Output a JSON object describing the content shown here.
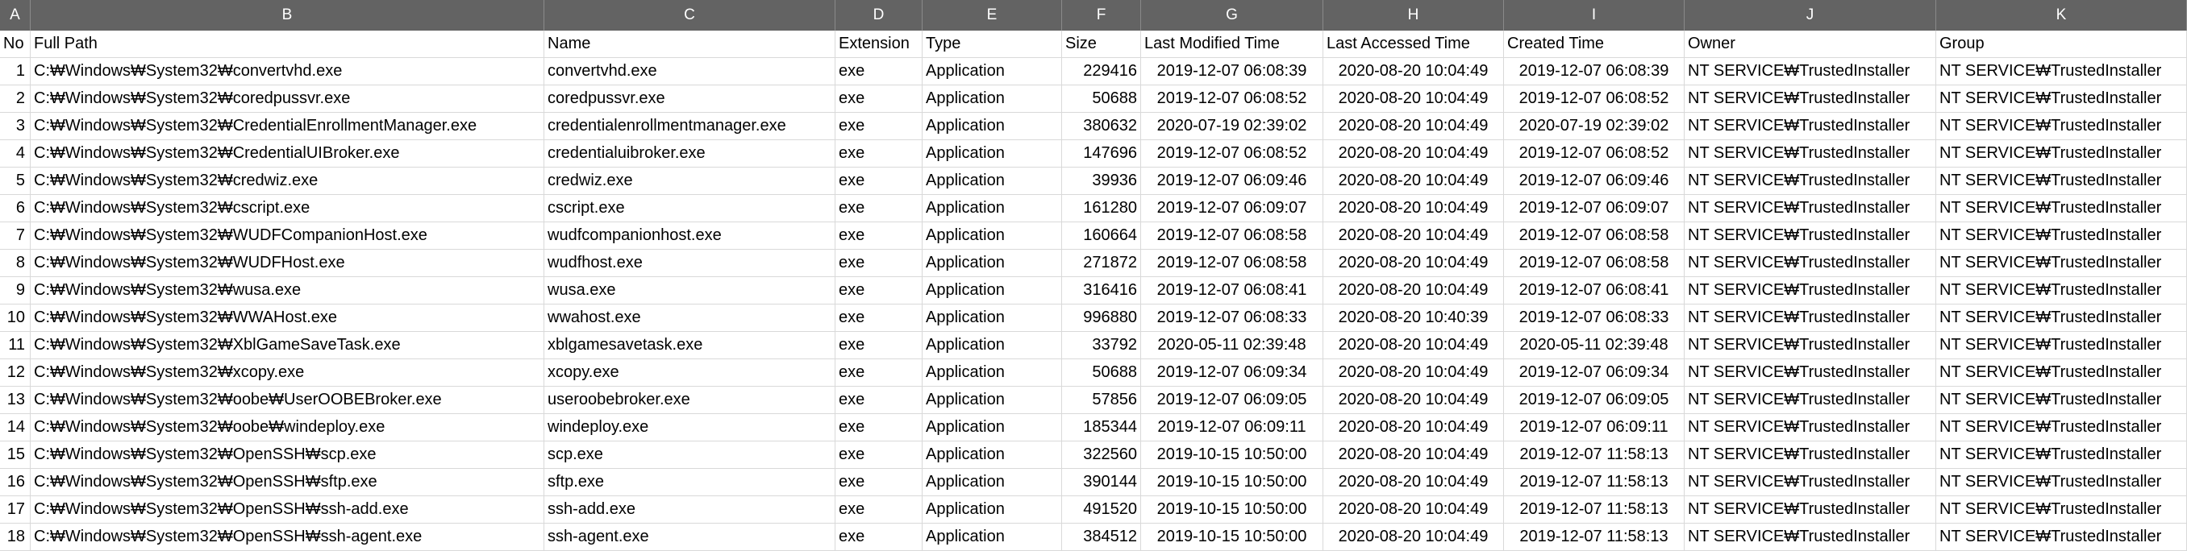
{
  "column_letters": [
    "A",
    "B",
    "C",
    "D",
    "E",
    "F",
    "G",
    "H",
    "I",
    "J",
    "K"
  ],
  "headers": {
    "no": "No",
    "full_path": "Full Path",
    "name": "Name",
    "extension": "Extension",
    "type": "Type",
    "size": "Size",
    "last_modified": "Last Modified Time",
    "last_accessed": "Last Accessed Time",
    "created": "Created Time",
    "owner": "Owner",
    "group": "Group"
  },
  "rows": [
    {
      "no": "1",
      "full_path": "C:₩Windows₩System32₩convertvhd.exe",
      "name": "convertvhd.exe",
      "extension": "exe",
      "type": "Application",
      "size": "229416",
      "last_modified": "2019-12-07 06:08:39",
      "last_accessed": "2020-08-20 10:04:49",
      "created": "2019-12-07 06:08:39",
      "owner": "NT SERVICE₩TrustedInstaller",
      "group": "NT SERVICE₩TrustedInstaller"
    },
    {
      "no": "2",
      "full_path": "C:₩Windows₩System32₩coredpussvr.exe",
      "name": "coredpussvr.exe",
      "extension": "exe",
      "type": "Application",
      "size": "50688",
      "last_modified": "2019-12-07 06:08:52",
      "last_accessed": "2020-08-20 10:04:49",
      "created": "2019-12-07 06:08:52",
      "owner": "NT SERVICE₩TrustedInstaller",
      "group": "NT SERVICE₩TrustedInstaller"
    },
    {
      "no": "3",
      "full_path": "C:₩Windows₩System32₩CredentialEnrollmentManager.exe",
      "name": "credentialenrollmentmanager.exe",
      "extension": "exe",
      "type": "Application",
      "size": "380632",
      "last_modified": "2020-07-19 02:39:02",
      "last_accessed": "2020-08-20 10:04:49",
      "created": "2020-07-19 02:39:02",
      "owner": "NT SERVICE₩TrustedInstaller",
      "group": "NT SERVICE₩TrustedInstaller"
    },
    {
      "no": "4",
      "full_path": "C:₩Windows₩System32₩CredentialUIBroker.exe",
      "name": "credentialuibroker.exe",
      "extension": "exe",
      "type": "Application",
      "size": "147696",
      "last_modified": "2019-12-07 06:08:52",
      "last_accessed": "2020-08-20 10:04:49",
      "created": "2019-12-07 06:08:52",
      "owner": "NT SERVICE₩TrustedInstaller",
      "group": "NT SERVICE₩TrustedInstaller"
    },
    {
      "no": "5",
      "full_path": "C:₩Windows₩System32₩credwiz.exe",
      "name": "credwiz.exe",
      "extension": "exe",
      "type": "Application",
      "size": "39936",
      "last_modified": "2019-12-07 06:09:46",
      "last_accessed": "2020-08-20 10:04:49",
      "created": "2019-12-07 06:09:46",
      "owner": "NT SERVICE₩TrustedInstaller",
      "group": "NT SERVICE₩TrustedInstaller"
    },
    {
      "no": "6",
      "full_path": "C:₩Windows₩System32₩cscript.exe",
      "name": "cscript.exe",
      "extension": "exe",
      "type": "Application",
      "size": "161280",
      "last_modified": "2019-12-07 06:09:07",
      "last_accessed": "2020-08-20 10:04:49",
      "created": "2019-12-07 06:09:07",
      "owner": "NT SERVICE₩TrustedInstaller",
      "group": "NT SERVICE₩TrustedInstaller"
    },
    {
      "no": "7",
      "full_path": "C:₩Windows₩System32₩WUDFCompanionHost.exe",
      "name": "wudfcompanionhost.exe",
      "extension": "exe",
      "type": "Application",
      "size": "160664",
      "last_modified": "2019-12-07 06:08:58",
      "last_accessed": "2020-08-20 10:04:49",
      "created": "2019-12-07 06:08:58",
      "owner": "NT SERVICE₩TrustedInstaller",
      "group": "NT SERVICE₩TrustedInstaller"
    },
    {
      "no": "8",
      "full_path": "C:₩Windows₩System32₩WUDFHost.exe",
      "name": "wudfhost.exe",
      "extension": "exe",
      "type": "Application",
      "size": "271872",
      "last_modified": "2019-12-07 06:08:58",
      "last_accessed": "2020-08-20 10:04:49",
      "created": "2019-12-07 06:08:58",
      "owner": "NT SERVICE₩TrustedInstaller",
      "group": "NT SERVICE₩TrustedInstaller"
    },
    {
      "no": "9",
      "full_path": "C:₩Windows₩System32₩wusa.exe",
      "name": "wusa.exe",
      "extension": "exe",
      "type": "Application",
      "size": "316416",
      "last_modified": "2019-12-07 06:08:41",
      "last_accessed": "2020-08-20 10:04:49",
      "created": "2019-12-07 06:08:41",
      "owner": "NT SERVICE₩TrustedInstaller",
      "group": "NT SERVICE₩TrustedInstaller"
    },
    {
      "no": "10",
      "full_path": "C:₩Windows₩System32₩WWAHost.exe",
      "name": "wwahost.exe",
      "extension": "exe",
      "type": "Application",
      "size": "996880",
      "last_modified": "2019-12-07 06:08:33",
      "last_accessed": "2020-08-20 10:40:39",
      "created": "2019-12-07 06:08:33",
      "owner": "NT SERVICE₩TrustedInstaller",
      "group": "NT SERVICE₩TrustedInstaller"
    },
    {
      "no": "11",
      "full_path": "C:₩Windows₩System32₩XblGameSaveTask.exe",
      "name": "xblgamesavetask.exe",
      "extension": "exe",
      "type": "Application",
      "size": "33792",
      "last_modified": "2020-05-11 02:39:48",
      "last_accessed": "2020-08-20 10:04:49",
      "created": "2020-05-11 02:39:48",
      "owner": "NT SERVICE₩TrustedInstaller",
      "group": "NT SERVICE₩TrustedInstaller"
    },
    {
      "no": "12",
      "full_path": "C:₩Windows₩System32₩xcopy.exe",
      "name": "xcopy.exe",
      "extension": "exe",
      "type": "Application",
      "size": "50688",
      "last_modified": "2019-12-07 06:09:34",
      "last_accessed": "2020-08-20 10:04:49",
      "created": "2019-12-07 06:09:34",
      "owner": "NT SERVICE₩TrustedInstaller",
      "group": "NT SERVICE₩TrustedInstaller"
    },
    {
      "no": "13",
      "full_path": "C:₩Windows₩System32₩oobe₩UserOOBEBroker.exe",
      "name": "useroobebroker.exe",
      "extension": "exe",
      "type": "Application",
      "size": "57856",
      "last_modified": "2019-12-07 06:09:05",
      "last_accessed": "2020-08-20 10:04:49",
      "created": "2019-12-07 06:09:05",
      "owner": "NT SERVICE₩TrustedInstaller",
      "group": "NT SERVICE₩TrustedInstaller"
    },
    {
      "no": "14",
      "full_path": "C:₩Windows₩System32₩oobe₩windeploy.exe",
      "name": "windeploy.exe",
      "extension": "exe",
      "type": "Application",
      "size": "185344",
      "last_modified": "2019-12-07 06:09:11",
      "last_accessed": "2020-08-20 10:04:49",
      "created": "2019-12-07 06:09:11",
      "owner": "NT SERVICE₩TrustedInstaller",
      "group": "NT SERVICE₩TrustedInstaller"
    },
    {
      "no": "15",
      "full_path": "C:₩Windows₩System32₩OpenSSH₩scp.exe",
      "name": "scp.exe",
      "extension": "exe",
      "type": "Application",
      "size": "322560",
      "last_modified": "2019-10-15 10:50:00",
      "last_accessed": "2020-08-20 10:04:49",
      "created": "2019-12-07 11:58:13",
      "owner": "NT SERVICE₩TrustedInstaller",
      "group": "NT SERVICE₩TrustedInstaller"
    },
    {
      "no": "16",
      "full_path": "C:₩Windows₩System32₩OpenSSH₩sftp.exe",
      "name": "sftp.exe",
      "extension": "exe",
      "type": "Application",
      "size": "390144",
      "last_modified": "2019-10-15 10:50:00",
      "last_accessed": "2020-08-20 10:04:49",
      "created": "2019-12-07 11:58:13",
      "owner": "NT SERVICE₩TrustedInstaller",
      "group": "NT SERVICE₩TrustedInstaller"
    },
    {
      "no": "17",
      "full_path": "C:₩Windows₩System32₩OpenSSH₩ssh-add.exe",
      "name": "ssh-add.exe",
      "extension": "exe",
      "type": "Application",
      "size": "491520",
      "last_modified": "2019-10-15 10:50:00",
      "last_accessed": "2020-08-20 10:04:49",
      "created": "2019-12-07 11:58:13",
      "owner": "NT SERVICE₩TrustedInstaller",
      "group": "NT SERVICE₩TrustedInstaller"
    },
    {
      "no": "18",
      "full_path": "C:₩Windows₩System32₩OpenSSH₩ssh-agent.exe",
      "name": "ssh-agent.exe",
      "extension": "exe",
      "type": "Application",
      "size": "384512",
      "last_modified": "2019-10-15 10:50:00",
      "last_accessed": "2020-08-20 10:04:49",
      "created": "2019-12-07 11:58:13",
      "owner": "NT SERVICE₩TrustedInstaller",
      "group": "NT SERVICE₩TrustedInstaller"
    }
  ]
}
